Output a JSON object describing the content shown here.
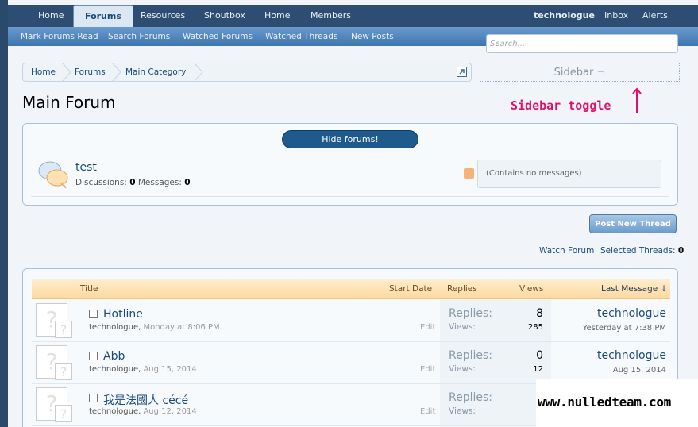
{
  "nav": {
    "tabs": [
      {
        "label": "Home"
      },
      {
        "label": "Forums"
      },
      {
        "label": "Resources"
      },
      {
        "label": "Shoutbox"
      },
      {
        "label": "Home"
      },
      {
        "label": "Members"
      }
    ],
    "right": {
      "user": "technologue",
      "inbox": "Inbox",
      "alerts": "Alerts"
    }
  },
  "subnav": {
    "items": [
      "Mark Forums Read",
      "Search Forums",
      "Watched Forums",
      "Watched Threads",
      "New Posts"
    ]
  },
  "search": {
    "placeholder": "Search..."
  },
  "breadcrumb": [
    "Home",
    "Forums",
    "Main Category"
  ],
  "sidebar_toggle": {
    "label": "Sidebar ¬",
    "annotation": "Sidebar toggle"
  },
  "page_title": "Main Forum",
  "forum_list": {
    "hide_button": "Hide forums!",
    "forum": {
      "name": "test",
      "discussions_label": "Discussions:",
      "discussions": "0",
      "messages_label": "Messages:",
      "messages": "0",
      "last_post": "(Contains no messages)"
    }
  },
  "post_new_thread": "Post New Thread",
  "watch_forum": "Watch Forum",
  "selected_threads_label": "Selected Threads:",
  "selected_threads_count": "0",
  "thread_table": {
    "headers": {
      "title": "Title",
      "start_date": "Start Date",
      "replies": "Replies",
      "views": "Views",
      "last_message": "Last Message ↓"
    },
    "rows": [
      {
        "title": "Hotline",
        "author": "technologue",
        "date": "Monday at 8:06 PM",
        "edit": "Edit",
        "replies_label": "Replies:",
        "replies": "8",
        "views_label": "Views:",
        "views": "285",
        "last_user": "technologue",
        "last_date": "Yesterday at 7:38 PM"
      },
      {
        "title": "Abb",
        "author": "technologue",
        "date": "Aug 15, 2014",
        "edit": "Edit",
        "replies_label": "Replies:",
        "replies": "0",
        "views_label": "Views:",
        "views": "12",
        "last_user": "technologue",
        "last_date": "Aug 15, 2014"
      },
      {
        "title": "我是法國人 cécé",
        "author": "technologue",
        "date": "Aug 12, 2014",
        "edit": "Edit",
        "replies_label": "Replies:",
        "replies": "",
        "views_label": "Views:",
        "views": "",
        "last_user": "",
        "last_date": ""
      }
    ]
  },
  "watermark": "www.nulledteam.com",
  "colors": {
    "nav_bg": "#2d4e72",
    "accent": "#1b4a7a",
    "annotation": "#e0106a"
  }
}
